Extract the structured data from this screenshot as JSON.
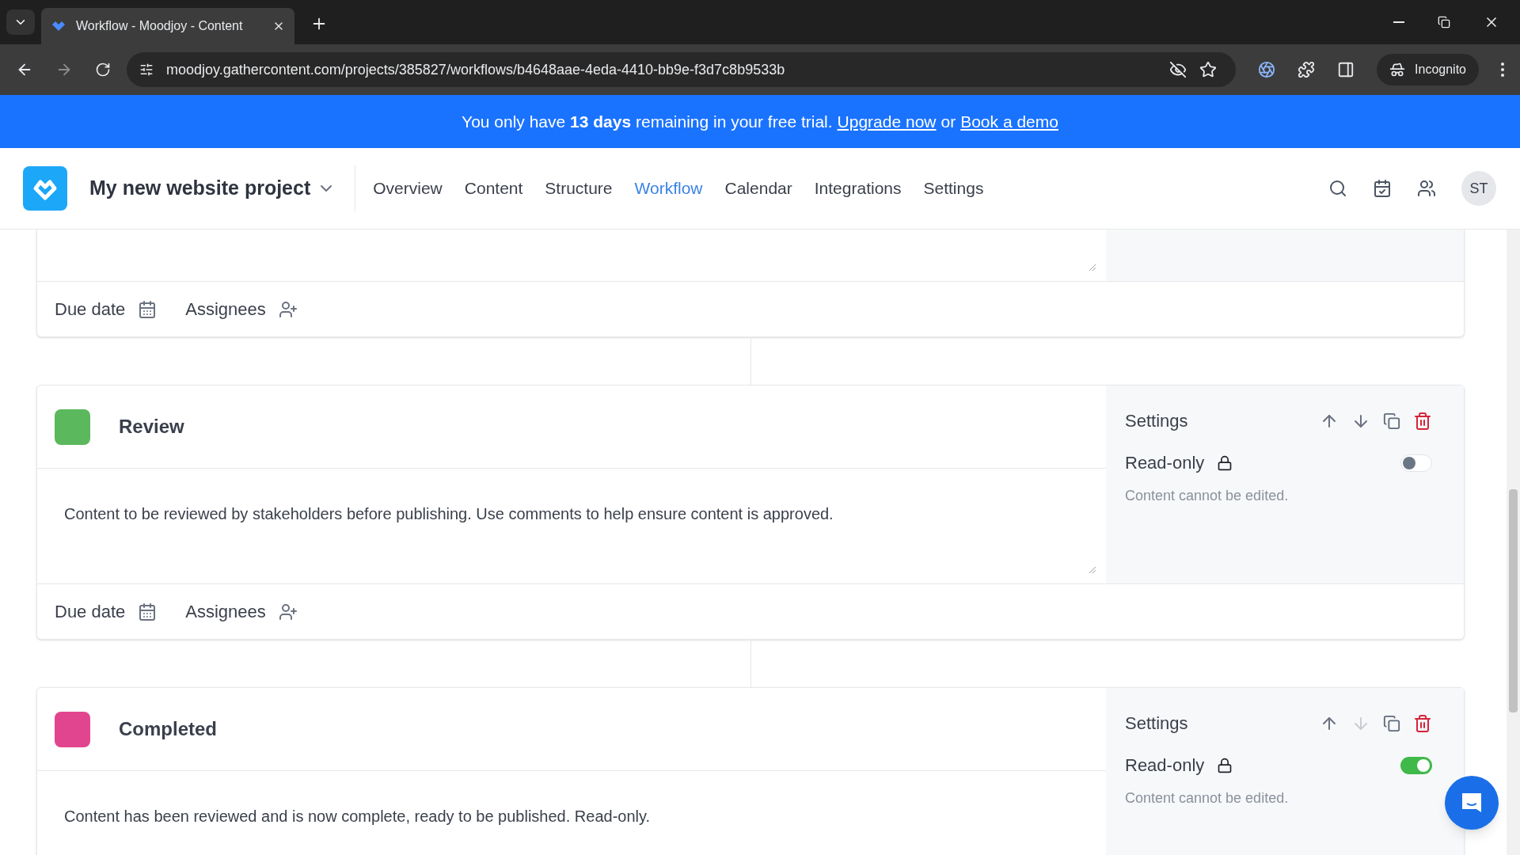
{
  "browser": {
    "tab_title": "Workflow - Moodjoy - Content",
    "url": "moodjoy.gathercontent.com/projects/385827/workflows/b4648aae-4eda-4410-bb9e-f3d7c8b9533b",
    "profile": "Incognito"
  },
  "banner": {
    "text": "You only have **13 days** remaining in your free trial.",
    "link_1": "Upgrade now",
    "joiner": "or",
    "link_2": "Book a demo"
  },
  "header": {
    "project": "My new website project",
    "avatar": "ST",
    "nav": [
      {
        "label": "Overview",
        "selected": false
      },
      {
        "label": "Content",
        "selected": false
      },
      {
        "label": "Structure",
        "selected": false
      },
      {
        "label": "Workflow",
        "selected": true
      },
      {
        "label": "Calendar",
        "selected": false
      },
      {
        "label": "Integrations",
        "selected": false
      },
      {
        "label": "Settings",
        "selected": false
      }
    ]
  },
  "stages": [
    {
      "kind": "partial",
      "footer": {
        "due_date": "Due date",
        "assignees": "Assignees"
      }
    },
    {
      "kind": "full",
      "name": "Review",
      "color": "#5cb85c",
      "description": "Content to be reviewed by stakeholders before publishing. Use comments to help ensure content is approved.",
      "settings": {
        "title": "Settings",
        "read_only_label": "Read-only",
        "read_only": false,
        "hint": "Content cannot be edited.",
        "move_down_disabled": false
      },
      "footer": {
        "due_date": "Due date",
        "assignees": "Assignees"
      }
    },
    {
      "kind": "full",
      "name": "Completed",
      "color": "#e2458f",
      "description": "Content has been reviewed and is now complete, ready to be published. Read-only.",
      "settings": {
        "title": "Settings",
        "read_only_label": "Read-only",
        "read_only": true,
        "hint": "Content cannot be edited.",
        "move_down_disabled": true
      }
    }
  ]
}
